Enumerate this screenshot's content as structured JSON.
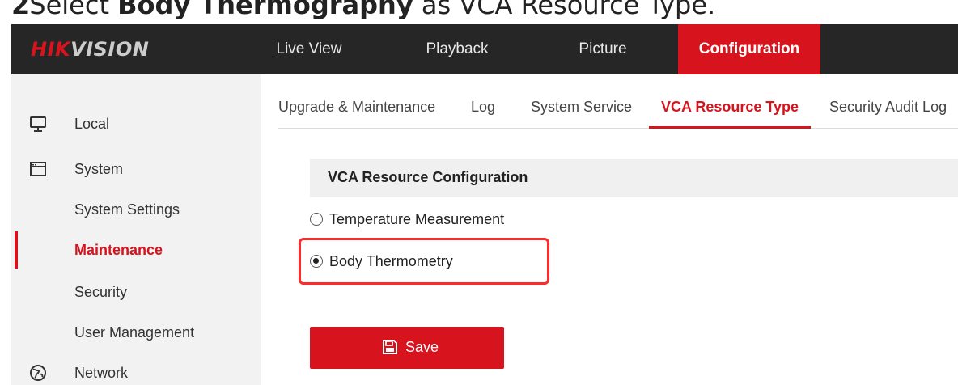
{
  "caption": {
    "number": "2",
    "prefix": "Select ",
    "bold": "Body Thermography",
    "suffix": " as VCA Resource Type."
  },
  "brand": {
    "logo_hik": "HIK",
    "logo_vision": "VISION",
    "accent": "#d7141e"
  },
  "topnav": {
    "items": [
      {
        "label": "Live View"
      },
      {
        "label": "Playback"
      },
      {
        "label": "Picture"
      },
      {
        "label": "Configuration",
        "active": true
      }
    ]
  },
  "sidebar": {
    "items": [
      {
        "label": "Local",
        "icon": "monitor-icon"
      },
      {
        "label": "System",
        "icon": "window-icon"
      },
      {
        "label": "System Settings"
      },
      {
        "label": "Maintenance",
        "active": true
      },
      {
        "label": "Security"
      },
      {
        "label": "User Management"
      },
      {
        "label": "Network",
        "icon": "globe-icon"
      }
    ]
  },
  "tabs": {
    "items": [
      {
        "label": "Upgrade & Maintenance"
      },
      {
        "label": "Log"
      },
      {
        "label": "System Service"
      },
      {
        "label": "VCA Resource Type",
        "active": true
      },
      {
        "label": "Security Audit Log"
      }
    ]
  },
  "section": {
    "title": "VCA Resource Configuration",
    "options": [
      {
        "label": "Temperature Measurement",
        "checked": false
      },
      {
        "label": "Body Thermometry",
        "checked": true
      }
    ]
  },
  "actions": {
    "save_label": "Save",
    "save_icon": "floppy-disk-icon"
  }
}
